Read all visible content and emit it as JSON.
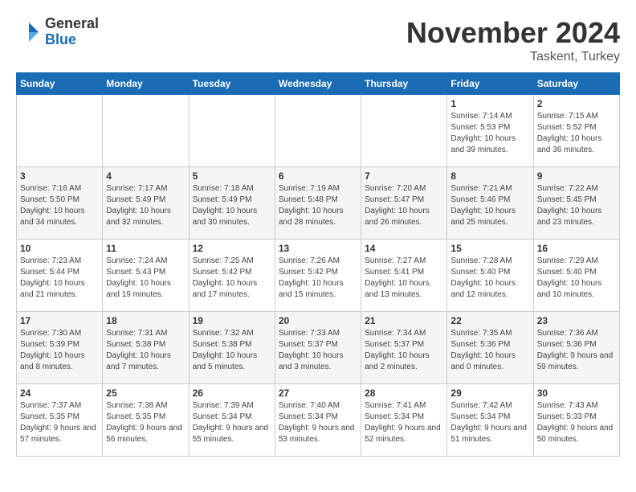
{
  "header": {
    "logo": {
      "general": "General",
      "blue": "Blue"
    },
    "month": "November 2024",
    "location": "Taskent, Turkey"
  },
  "weekdays": [
    "Sunday",
    "Monday",
    "Tuesday",
    "Wednesday",
    "Thursday",
    "Friday",
    "Saturday"
  ],
  "weeks": [
    [
      {
        "day": "",
        "info": ""
      },
      {
        "day": "",
        "info": ""
      },
      {
        "day": "",
        "info": ""
      },
      {
        "day": "",
        "info": ""
      },
      {
        "day": "",
        "info": ""
      },
      {
        "day": "1",
        "info": "Sunrise: 7:14 AM\nSunset: 5:53 PM\nDaylight: 10 hours and 39 minutes."
      },
      {
        "day": "2",
        "info": "Sunrise: 7:15 AM\nSunset: 5:52 PM\nDaylight: 10 hours and 36 minutes."
      }
    ],
    [
      {
        "day": "3",
        "info": "Sunrise: 7:16 AM\nSunset: 5:50 PM\nDaylight: 10 hours and 34 minutes."
      },
      {
        "day": "4",
        "info": "Sunrise: 7:17 AM\nSunset: 5:49 PM\nDaylight: 10 hours and 32 minutes."
      },
      {
        "day": "5",
        "info": "Sunrise: 7:18 AM\nSunset: 5:49 PM\nDaylight: 10 hours and 30 minutes."
      },
      {
        "day": "6",
        "info": "Sunrise: 7:19 AM\nSunset: 5:48 PM\nDaylight: 10 hours and 28 minutes."
      },
      {
        "day": "7",
        "info": "Sunrise: 7:20 AM\nSunset: 5:47 PM\nDaylight: 10 hours and 26 minutes."
      },
      {
        "day": "8",
        "info": "Sunrise: 7:21 AM\nSunset: 5:46 PM\nDaylight: 10 hours and 25 minutes."
      },
      {
        "day": "9",
        "info": "Sunrise: 7:22 AM\nSunset: 5:45 PM\nDaylight: 10 hours and 23 minutes."
      }
    ],
    [
      {
        "day": "10",
        "info": "Sunrise: 7:23 AM\nSunset: 5:44 PM\nDaylight: 10 hours and 21 minutes."
      },
      {
        "day": "11",
        "info": "Sunrise: 7:24 AM\nSunset: 5:43 PM\nDaylight: 10 hours and 19 minutes."
      },
      {
        "day": "12",
        "info": "Sunrise: 7:25 AM\nSunset: 5:42 PM\nDaylight: 10 hours and 17 minutes."
      },
      {
        "day": "13",
        "info": "Sunrise: 7:26 AM\nSunset: 5:42 PM\nDaylight: 10 hours and 15 minutes."
      },
      {
        "day": "14",
        "info": "Sunrise: 7:27 AM\nSunset: 5:41 PM\nDaylight: 10 hours and 13 minutes."
      },
      {
        "day": "15",
        "info": "Sunrise: 7:28 AM\nSunset: 5:40 PM\nDaylight: 10 hours and 12 minutes."
      },
      {
        "day": "16",
        "info": "Sunrise: 7:29 AM\nSunset: 5:40 PM\nDaylight: 10 hours and 10 minutes."
      }
    ],
    [
      {
        "day": "17",
        "info": "Sunrise: 7:30 AM\nSunset: 5:39 PM\nDaylight: 10 hours and 8 minutes."
      },
      {
        "day": "18",
        "info": "Sunrise: 7:31 AM\nSunset: 5:38 PM\nDaylight: 10 hours and 7 minutes."
      },
      {
        "day": "19",
        "info": "Sunrise: 7:32 AM\nSunset: 5:38 PM\nDaylight: 10 hours and 5 minutes."
      },
      {
        "day": "20",
        "info": "Sunrise: 7:33 AM\nSunset: 5:37 PM\nDaylight: 10 hours and 3 minutes."
      },
      {
        "day": "21",
        "info": "Sunrise: 7:34 AM\nSunset: 5:37 PM\nDaylight: 10 hours and 2 minutes."
      },
      {
        "day": "22",
        "info": "Sunrise: 7:35 AM\nSunset: 5:36 PM\nDaylight: 10 hours and 0 minutes."
      },
      {
        "day": "23",
        "info": "Sunrise: 7:36 AM\nSunset: 5:36 PM\nDaylight: 9 hours and 59 minutes."
      }
    ],
    [
      {
        "day": "24",
        "info": "Sunrise: 7:37 AM\nSunset: 5:35 PM\nDaylight: 9 hours and 57 minutes."
      },
      {
        "day": "25",
        "info": "Sunrise: 7:38 AM\nSunset: 5:35 PM\nDaylight: 9 hours and 56 minutes."
      },
      {
        "day": "26",
        "info": "Sunrise: 7:39 AM\nSunset: 5:34 PM\nDaylight: 9 hours and 55 minutes."
      },
      {
        "day": "27",
        "info": "Sunrise: 7:40 AM\nSunset: 5:34 PM\nDaylight: 9 hours and 53 minutes."
      },
      {
        "day": "28",
        "info": "Sunrise: 7:41 AM\nSunset: 5:34 PM\nDaylight: 9 hours and 52 minutes."
      },
      {
        "day": "29",
        "info": "Sunrise: 7:42 AM\nSunset: 5:34 PM\nDaylight: 9 hours and 51 minutes."
      },
      {
        "day": "30",
        "info": "Sunrise: 7:43 AM\nSunset: 5:33 PM\nDaylight: 9 hours and 50 minutes."
      }
    ]
  ]
}
